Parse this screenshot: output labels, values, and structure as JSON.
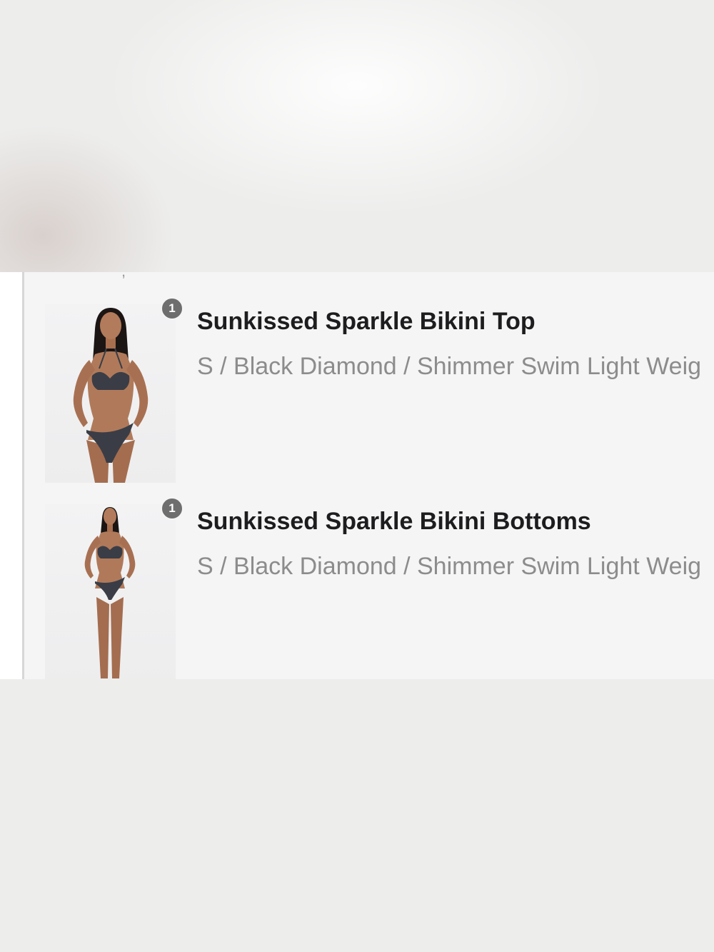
{
  "order_items": [
    {
      "quantity": "1",
      "title": "Sunkissed Sparkle Bikini Top",
      "variant": "S / Black Diamond / Shimmer Swim Light Weig",
      "image_alt": "model wearing black sparkle bikini top"
    },
    {
      "quantity": "1",
      "title": "Sunkissed Sparkle Bikini Bottoms",
      "variant": "S / Black Diamond / Shimmer Swim Light Weig",
      "image_alt": "model wearing black sparkle bikini bottoms"
    }
  ],
  "partial_text_above": ",",
  "colors": {
    "panel_bg": "#f5f5f5",
    "title": "#1d1d1f",
    "variant": "#8c8c8c",
    "badge": "#6e6e6e"
  }
}
